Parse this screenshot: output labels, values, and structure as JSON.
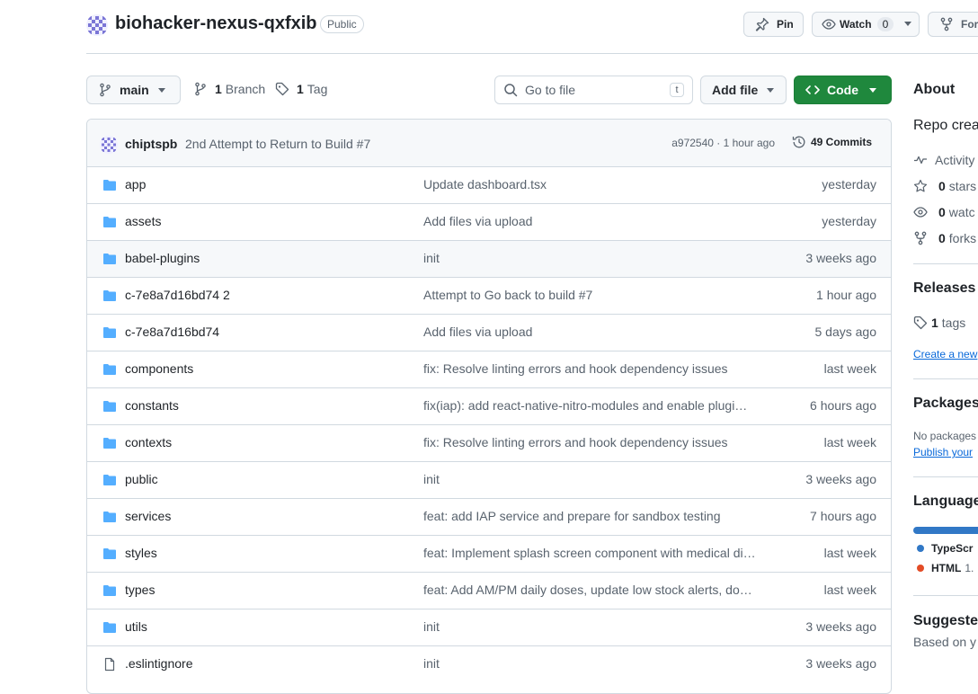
{
  "repo": {
    "name": "biohacker-nexus-qxfxib",
    "visibility": "Public"
  },
  "header_actions": {
    "pin_label": "Pin",
    "watch_label": "Watch",
    "watch_count": "0",
    "fork_label": "For"
  },
  "toolbar": {
    "branch_name": "main",
    "branch_count": "1",
    "branch_label": "Branch",
    "tag_count": "1",
    "tag_label": "Tag",
    "search_placeholder": "Go to file",
    "search_shortcut": "t",
    "add_file_label": "Add file",
    "code_label": "Code"
  },
  "latest_commit": {
    "author": "chiptspb",
    "message": "2nd Attempt to Return to Build #7",
    "sha_time": "a972540 · 1 hour ago",
    "commits_count": "49 Commits"
  },
  "files": [
    {
      "type": "dir",
      "name": "app",
      "message": "Update dashboard.tsx",
      "date": "yesterday"
    },
    {
      "type": "dir",
      "name": "assets",
      "message": "Add files via upload",
      "date": "yesterday"
    },
    {
      "type": "dir",
      "name": "babel-plugins",
      "message": "init",
      "date": "3 weeks ago"
    },
    {
      "type": "dir",
      "name": "c-7e8a7d16bd74 2",
      "message": "Attempt to Go back to build #7",
      "date": "1 hour ago"
    },
    {
      "type": "dir",
      "name": "c-7e8a7d16bd74",
      "message": "Add files via upload",
      "date": "5 days ago"
    },
    {
      "type": "dir",
      "name": "components",
      "message": "fix: Resolve linting errors and hook dependency issues",
      "date": "last week"
    },
    {
      "type": "dir",
      "name": "constants",
      "message": "fix(iap): add react-native-nitro-modules and enable plugi…",
      "date": "6 hours ago"
    },
    {
      "type": "dir",
      "name": "contexts",
      "message": "fix: Resolve linting errors and hook dependency issues",
      "date": "last week"
    },
    {
      "type": "dir",
      "name": "public",
      "message": "init",
      "date": "3 weeks ago"
    },
    {
      "type": "dir",
      "name": "services",
      "message": "feat: add IAP service and prepare for sandbox testing",
      "date": "7 hours ago"
    },
    {
      "type": "dir",
      "name": "styles",
      "message": "feat: Implement splash screen component with medical di…",
      "date": "last week"
    },
    {
      "type": "dir",
      "name": "types",
      "message": "feat: Add AM/PM daily doses, update low stock alerts, do…",
      "date": "last week"
    },
    {
      "type": "dir",
      "name": "utils",
      "message": "init",
      "date": "3 weeks ago"
    },
    {
      "type": "file",
      "name": ".eslintignore",
      "message": "init",
      "date": "3 weeks ago"
    }
  ],
  "sidebar": {
    "about_title": "About",
    "description": "Repo crea",
    "activity_label": "Activity",
    "stars_count": "0",
    "stars_label": "stars",
    "watchers_count": "0",
    "watchers_label": "watc",
    "forks_count": "0",
    "forks_label": "forks",
    "releases_title": "Releases",
    "tags_count": "1",
    "tags_label": "tags",
    "create_release_link": "Create a new",
    "packages_title": "Packages",
    "packages_text": "No packages",
    "publish_link": "Publish your",
    "languages_title": "Language",
    "languages": [
      {
        "name": "TypeScr",
        "percent_text": "",
        "color": "#3178c6"
      },
      {
        "name": "HTML",
        "percent_text": "1.",
        "color": "#e34c26"
      }
    ],
    "suggested_title": "Suggeste",
    "suggested_text": "Based on y"
  },
  "colors": {
    "accent": "#1f883d",
    "link": "#0969da",
    "folder": "#54aeff"
  }
}
